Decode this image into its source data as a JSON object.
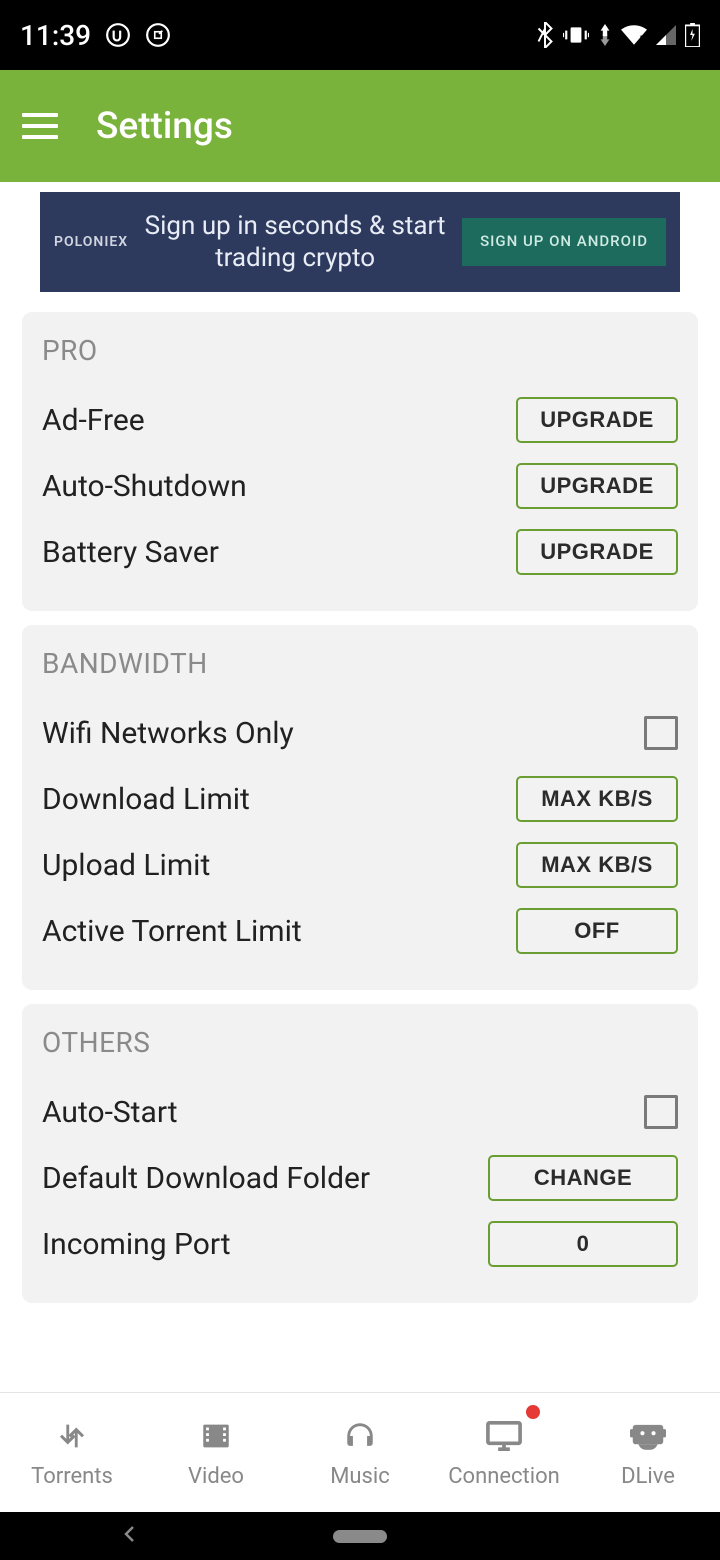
{
  "status": {
    "time": "11:39"
  },
  "header": {
    "title": "Settings"
  },
  "ad": {
    "brand": "POLONIEX",
    "text": "Sign up in seconds & start trading crypto",
    "cta": "SIGN UP ON ANDROID"
  },
  "sections": {
    "pro": {
      "title": "PRO",
      "items": [
        {
          "label": "Ad-Free",
          "button": "UPGRADE"
        },
        {
          "label": "Auto-Shutdown",
          "button": "UPGRADE"
        },
        {
          "label": "Battery Saver",
          "button": "UPGRADE"
        }
      ]
    },
    "bandwidth": {
      "title": "BANDWIDTH",
      "items": [
        {
          "label": "Wifi Networks Only",
          "checkbox": false
        },
        {
          "label": "Download Limit",
          "button": "MAX KB/S"
        },
        {
          "label": "Upload Limit",
          "button": "MAX KB/S"
        },
        {
          "label": "Active Torrent Limit",
          "button": "OFF"
        }
      ]
    },
    "others": {
      "title": "OTHERS",
      "items": [
        {
          "label": "Auto-Start",
          "checkbox": false
        },
        {
          "label": "Default Download Folder",
          "button": "CHANGE"
        },
        {
          "label": "Incoming Port",
          "button": "0"
        }
      ]
    }
  },
  "nav": {
    "items": [
      {
        "label": "Torrents"
      },
      {
        "label": "Video"
      },
      {
        "label": "Music"
      },
      {
        "label": "Connection",
        "badge": true
      },
      {
        "label": "DLive"
      }
    ]
  }
}
